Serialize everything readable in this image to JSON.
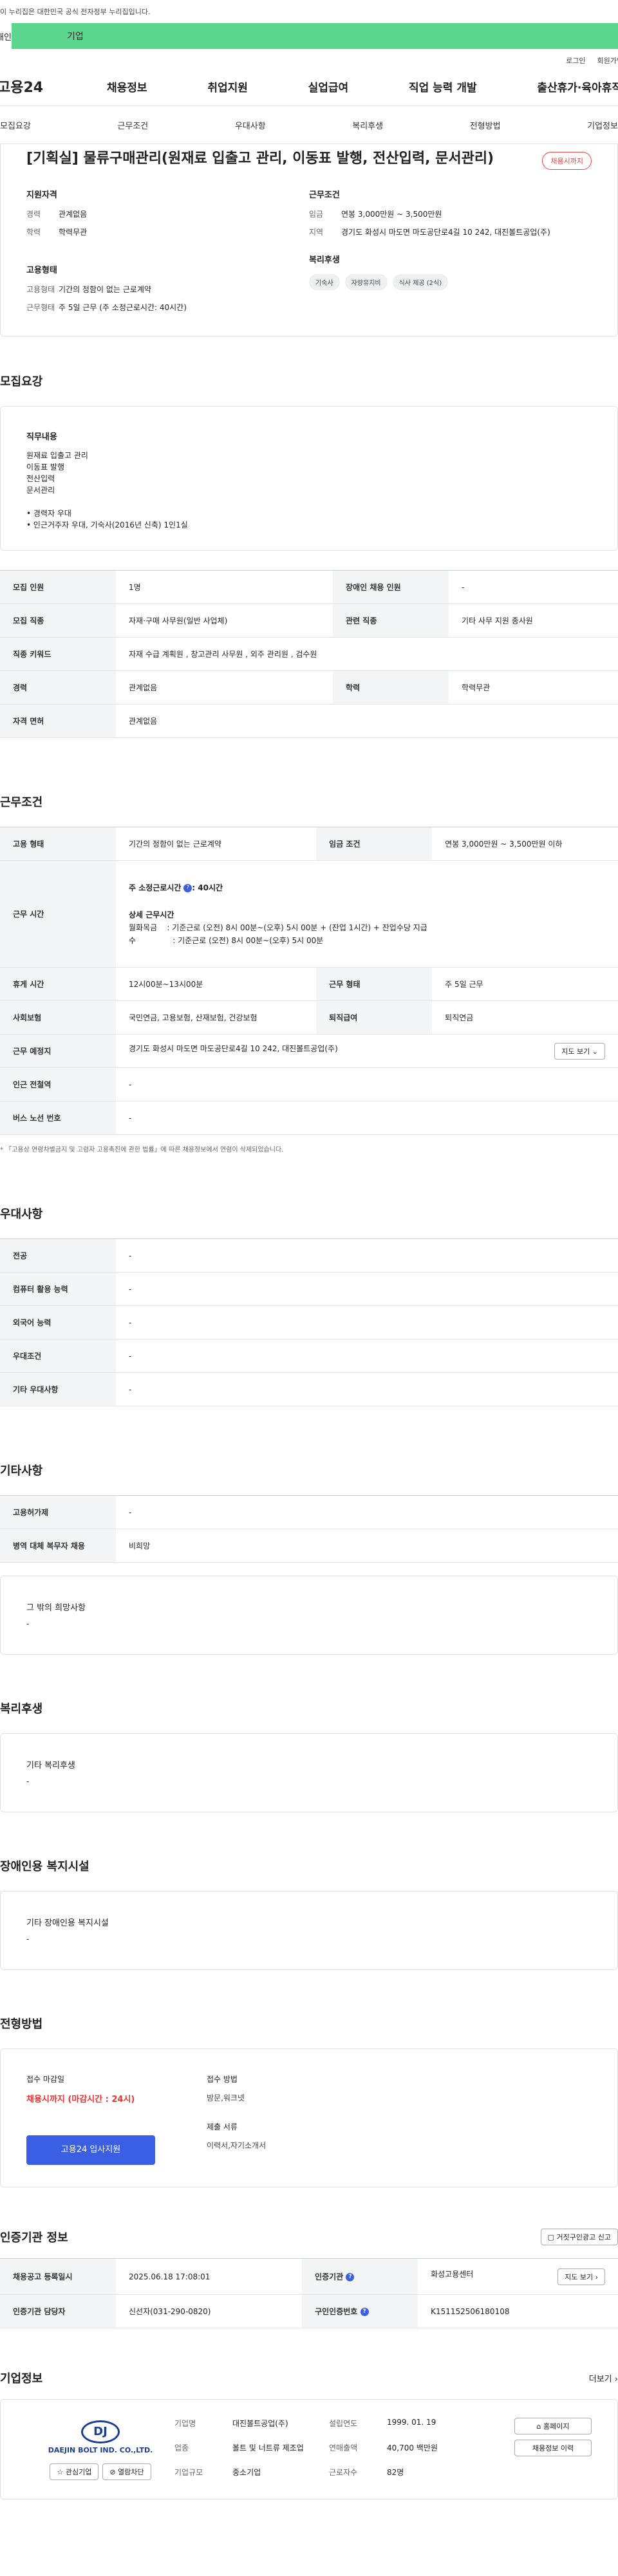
{
  "gov": {
    "notice": "이 누리집은 대한민국 공식 전자정부 누리집입니다."
  },
  "tabs": {
    "individual": "개인",
    "business": "기업"
  },
  "util": {
    "login": "로그인",
    "signup": "회원가입"
  },
  "gnb": {
    "logo": "고용24",
    "menu": [
      "채용정보",
      "취업지원",
      "실업급여",
      "직업 능력 개발",
      "출산휴가·육아휴직"
    ]
  },
  "subnav": [
    "모집요강",
    "근무조건",
    "우대사항",
    "복리후생",
    "전형방법",
    "기업정보"
  ],
  "job": {
    "title": "[기획실] 물류구매관리(원재료 입출고 관리, 이동표 발행, 전산입력, 문서관리)",
    "badge": "채용시까지"
  },
  "summary": {
    "left_head": "지원자격",
    "career_k": "경력",
    "career_v": "관계없음",
    "edu_k": "학력",
    "edu_v": "학력무관",
    "emp_head": "고용형태",
    "emp_k": "고용형태",
    "emp_v": "기간의 정함이 없는 근로계약",
    "work_k": "근무형태",
    "work_v": "주 5일 근무 (주 소정근로시간: 40시간)",
    "right_head": "근무조건",
    "wage_k": "임금",
    "wage_v": "연봉 3,000만원 ~ 3,500만원",
    "loc_k": "지역",
    "loc_v": "경기도 화성시 마도면 마도공단로4길 10 242, 대진볼트공업(주)",
    "welfare_head": "복리후생",
    "chips": [
      "기숙사",
      "자량유지비",
      "식사 제공 (2식)"
    ]
  },
  "recruit": {
    "title": "모집요강",
    "duty_head": "직무내용",
    "duties": [
      "원재료 입출고 관리",
      "이동표 발행",
      "전산입력",
      "문서관리"
    ],
    "prefs": [
      "• 경력자 우대",
      "• 인근거주자 우대, 기숙사(2016년 신축) 1인1실"
    ],
    "rows": [
      [
        "모집 인원",
        "1명",
        "장애인 채용 인원",
        "-"
      ],
      [
        "모집 직종",
        "자재·구매 사무원(일반 사업체)",
        "관련 직종",
        "기타 사무 지원 종사원"
      ],
      [
        "직종 키워드",
        "자재 수급 계획원 , 창고관리 사무원 , 외주 관리원 , 검수원",
        "",
        ""
      ],
      [
        "경력",
        "관계없음",
        "학력",
        "학력무관"
      ],
      [
        "자격 면허",
        "관계없음",
        "",
        ""
      ]
    ]
  },
  "work": {
    "title": "근무조건",
    "emp_k": "고용 형태",
    "emp_v": "기간의 정함이 없는 근로계약",
    "wage_k": "임금 조건",
    "wage_v": "연봉 3,000만원 ~ 3,500만원 이하",
    "time_k": "근무 시간",
    "time_l1": "주 소정근로시간",
    "time_l1v": ": 40시간",
    "time_l2": "상세 근무시간",
    "time_l3": "월화목금    : 기준근로 (오전) 8시 00분~(오후) 5시 00분 + (잔업 1시간) + 잔업수당 지급",
    "time_l4": "수               : 기준근로 (오전) 8시 00분~(오후) 5시 00분",
    "rest_k": "휴게 시간",
    "rest_v": "12시00분~13시00분",
    "type_k": "근무 형태",
    "type_v": "주 5일 근무",
    "ins_k": "사회보험",
    "ins_v": "국민연금, 고용보험, 산재보험, 건강보험",
    "ret_k": "퇴직급여",
    "ret_v": "퇴직연금",
    "place_k": "근무 예정지",
    "place_v": "경기도 화성시 마도면 마도공단로4길 10 242, 대진볼트공업(주)",
    "map_btn": "지도 보기",
    "sub_k": "인근 전철역",
    "sub_v": "-",
    "bus_k": "버스 노선 번호",
    "bus_v": "-",
    "note": "* 「고용상 연령차별금지 및 고령자 고용촉진에 관한 법률」에 따른 채용정보에서 연령이 삭제되었습니다."
  },
  "pref": {
    "title": "우대사항",
    "rows": [
      [
        "전공",
        "-"
      ],
      [
        "컴퓨터 활용 능력",
        "-"
      ],
      [
        "외국어 능력",
        "-"
      ],
      [
        "우대조건",
        "-"
      ],
      [
        "기타 우대사항",
        "-"
      ]
    ]
  },
  "etc": {
    "title": "기타사항",
    "rows": [
      [
        "고용허가제",
        "-"
      ],
      [
        "병역 대체 복무자 채용",
        "비희망"
      ]
    ],
    "box_head": "그 밖의 희망사항",
    "box_v": "-"
  },
  "welfare": {
    "title": "복리후생",
    "box_head": "기타 복리후생",
    "box_v": "-"
  },
  "disab": {
    "title": "장애인용 복지시설",
    "box_head": "기타 장애인용 복지시설",
    "box_v": "-"
  },
  "method": {
    "title": "전형방법",
    "deadline_k": "접수 마감일",
    "deadline_v": "채용시까지 (마감시간 : 24시)",
    "apply_btn": "고용24 입사지원",
    "how_k": "접수 방법",
    "how_v": "방문,워크넷",
    "docs_k": "제출 서류",
    "docs_v": "이력서,자기소개서"
  },
  "agency": {
    "title": "인증기관 정보",
    "report_btn": "거짓구인광고 신고",
    "reg_k": "채용공고 등록일시",
    "reg_v": "2025.06.18 17:08:01",
    "org_k": "인증기관",
    "org_v": "화성고용센터",
    "map_btn": "지도 보기",
    "mgr_k": "인증기관 담당자",
    "mgr_v": "신선자(031-290-0820)",
    "id_k": "구인인증번호",
    "id_v": "K151152506180108"
  },
  "company": {
    "title": "기업정보",
    "more": "더보기",
    "logo": "DJ",
    "logo_name": "DAEJIN BOLT IND. CO.,LTD.",
    "fav": "관심기업",
    "block": "열람차단",
    "name_k": "기업명",
    "name_v": "대진볼트공업(주)",
    "year_k": "설립연도",
    "year_v": "1999. 01. 19",
    "ind_k": "업종",
    "ind_v": "볼트 및 너트류 제조업",
    "sales_k": "연매출액",
    "sales_v": "40,700 백만원",
    "size_k": "기업규모",
    "size_v": "중소기업",
    "emp_k": "근로자수",
    "emp_v": "82명",
    "home_btn": "홈페이지",
    "jobs_btn": "채용정보 이력"
  },
  "colors": {
    "brand_green": "#5bd68c",
    "accent_blue": "#3a5fe5",
    "alert_red": "#e33333"
  }
}
